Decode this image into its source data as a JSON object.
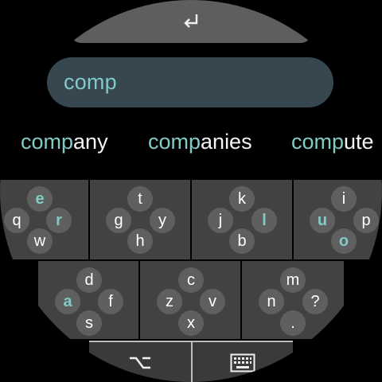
{
  "input": {
    "text": "comp"
  },
  "suggestions": [
    {
      "typed": "comp",
      "rest": "any"
    },
    {
      "typed": "comp",
      "rest": "anies"
    },
    {
      "typed": "comp",
      "rest": "ute"
    }
  ],
  "row1": [
    {
      "keys": [
        "e",
        "q",
        "r",
        "w"
      ],
      "accent": [
        "e",
        "r"
      ]
    },
    {
      "keys": [
        "t",
        "g",
        "y",
        "h"
      ],
      "accent": []
    },
    {
      "keys": [
        "k",
        "j",
        "l",
        "b"
      ],
      "accent": [
        "l"
      ]
    },
    {
      "keys": [
        "i",
        "u",
        "p",
        "o"
      ],
      "accent": [
        "u",
        "o"
      ]
    }
  ],
  "row2": [
    {
      "keys": [
        "d",
        "a",
        "f",
        "s"
      ],
      "accent": [
        "a"
      ]
    },
    {
      "keys": [
        "c",
        "z",
        "v",
        "x"
      ],
      "accent": []
    },
    {
      "keys": [
        "m",
        "n",
        "?",
        "."
      ],
      "accent": []
    }
  ],
  "icons": {
    "enter": "enter-icon",
    "symbols": "option-key-icon",
    "keyboard": "keyboard-icon"
  },
  "colors": {
    "accent": "#80cbc4",
    "field": "#37474f",
    "cluster": "#424242",
    "keycircle": "#5f5f5f"
  }
}
